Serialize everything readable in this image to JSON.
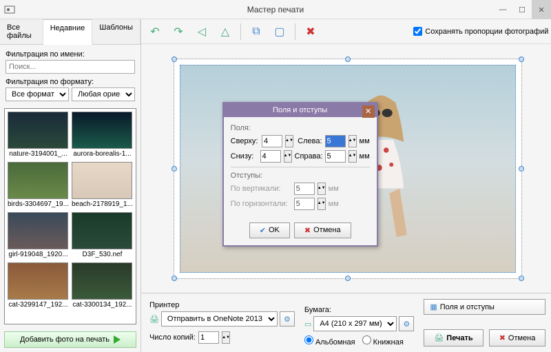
{
  "window": {
    "title": "Мастер печати"
  },
  "tabs": {
    "all_files": "Все файлы",
    "recent": "Недавние",
    "templates": "Шаблоны"
  },
  "filter": {
    "name_label": "Фильтрация по имени:",
    "search_placeholder": "Поиск...",
    "format_label": "Фильтрация по формату:",
    "all_formats": "Все форматы",
    "any_orientation": "Любая ориентация"
  },
  "thumbs": [
    {
      "cap": "nature-3194001_..."
    },
    {
      "cap": "aurora-borealis-1..."
    },
    {
      "cap": "birds-3304697_19..."
    },
    {
      "cap": "beach-2178919_1..."
    },
    {
      "cap": "girl-919048_1920..."
    },
    {
      "cap": "D3F_530.nef"
    },
    {
      "cap": "cat-3299147_192..."
    },
    {
      "cap": "cat-3300134_192..."
    }
  ],
  "add_button": "Добавить фото на печать",
  "keep_proportions": "Сохранять пропорции фотографий",
  "dialog": {
    "title": "Поля и отступы",
    "fields": "Поля:",
    "top": "Сверху:",
    "bottom": "Снизу:",
    "left": "Слева:",
    "right": "Справа:",
    "top_v": "4",
    "bottom_v": "4",
    "left_v": "5",
    "right_v": "5",
    "mm": "мм",
    "margins": "Отступы:",
    "vert": "По вертикали:",
    "horz": "По горизонтали:",
    "vert_v": "5",
    "horz_v": "5",
    "ok": "OK",
    "cancel": "Отмена"
  },
  "bottom": {
    "printer_label": "Принтер",
    "printer_value": "Отправить в OneNote 2013",
    "copies_label": "Число копий:",
    "copies_value": "1",
    "paper_label": "Бумага:",
    "paper_value": "A4 (210 x 297 мм)",
    "landscape": "Альбомная",
    "portrait": "Книжная",
    "margins_btn": "Поля и отступы",
    "print": "Печать",
    "cancel": "Отмена"
  }
}
